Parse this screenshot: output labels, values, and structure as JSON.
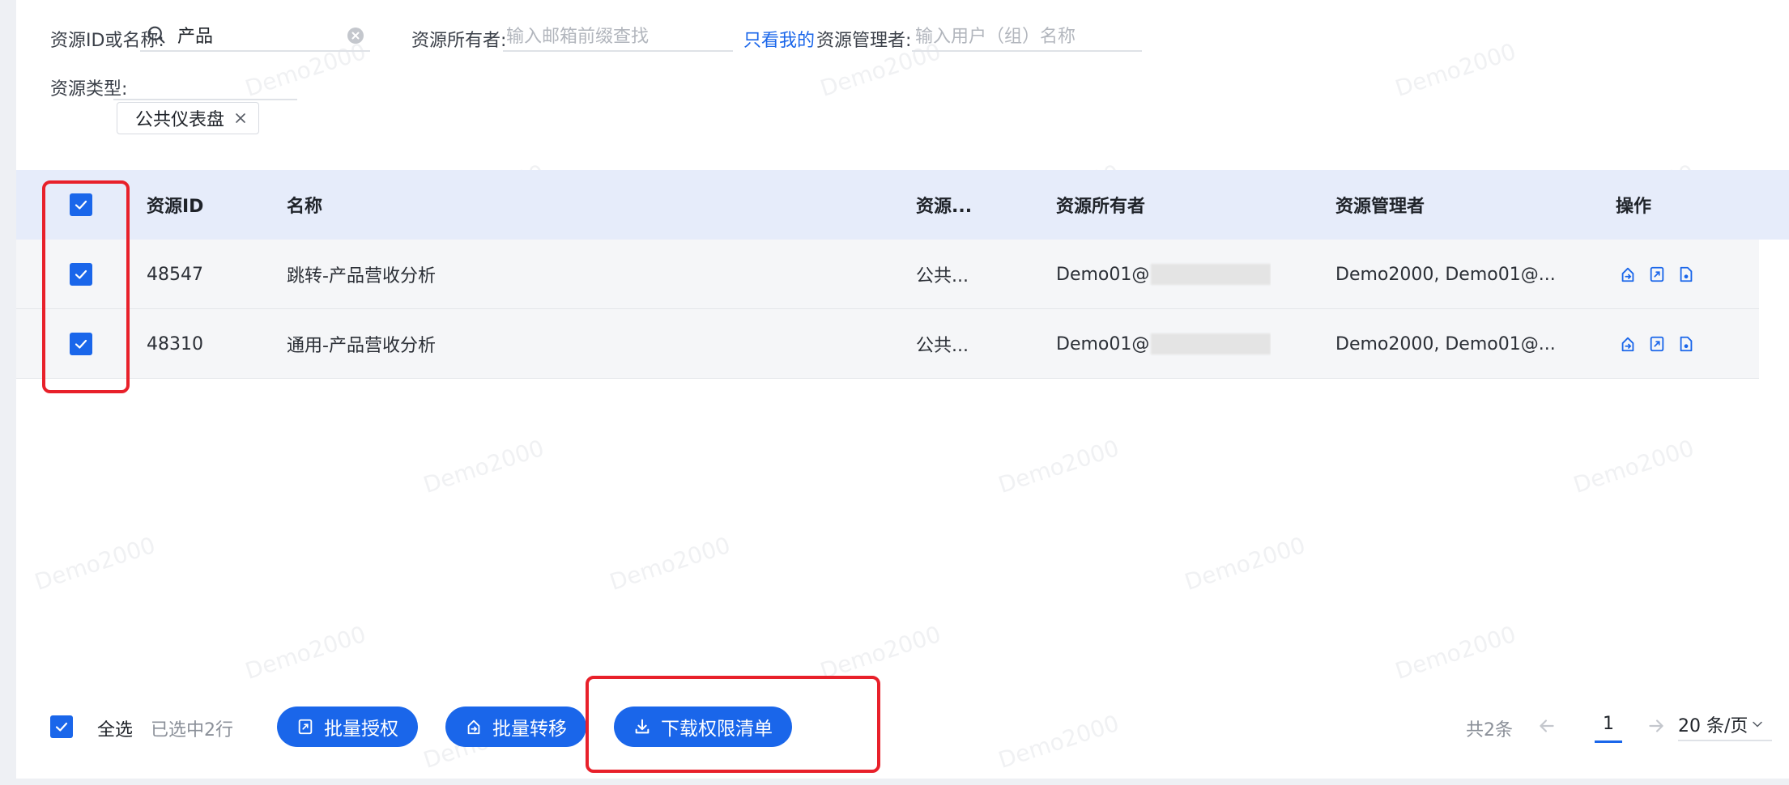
{
  "filters": {
    "resource_label": "资源ID或名称:",
    "resource_value": "产品",
    "owner_label": "资源所有者:",
    "owner_placeholder": "输入邮箱前缀查找",
    "only_mine": "只看我的",
    "manager_label": "资源管理者:",
    "manager_placeholder": "输入用户（组）名称",
    "type_label": "资源类型:",
    "type_tag": "公共仪表盘"
  },
  "table": {
    "columns": [
      "资源ID",
      "名称",
      "资源...",
      "资源所有者",
      "资源管理者",
      "操作"
    ],
    "rows": [
      {
        "id": "48547",
        "name": "跳转-产品营收分析",
        "type": "公共...",
        "owner": "Demo01@",
        "managers": "Demo2000, Demo01@...",
        "checked": true
      },
      {
        "id": "48310",
        "name": "通用-产品营收分析",
        "type": "公共...",
        "owner": "Demo01@",
        "managers": "Demo2000, Demo01@...",
        "checked": true
      }
    ]
  },
  "footer": {
    "select_all": "全选",
    "selected_count": "已选中2行",
    "batch_grant": "批量授权",
    "batch_transfer": "批量转移",
    "download_list": "下载权限清单",
    "total": "共2条",
    "current_page": "1",
    "page_size": "20 条/页"
  },
  "watermark": "Demo2000",
  "colors": {
    "accent": "#1a66ea",
    "highlight": "#e8202a",
    "header_bg": "#e6ecfa"
  }
}
